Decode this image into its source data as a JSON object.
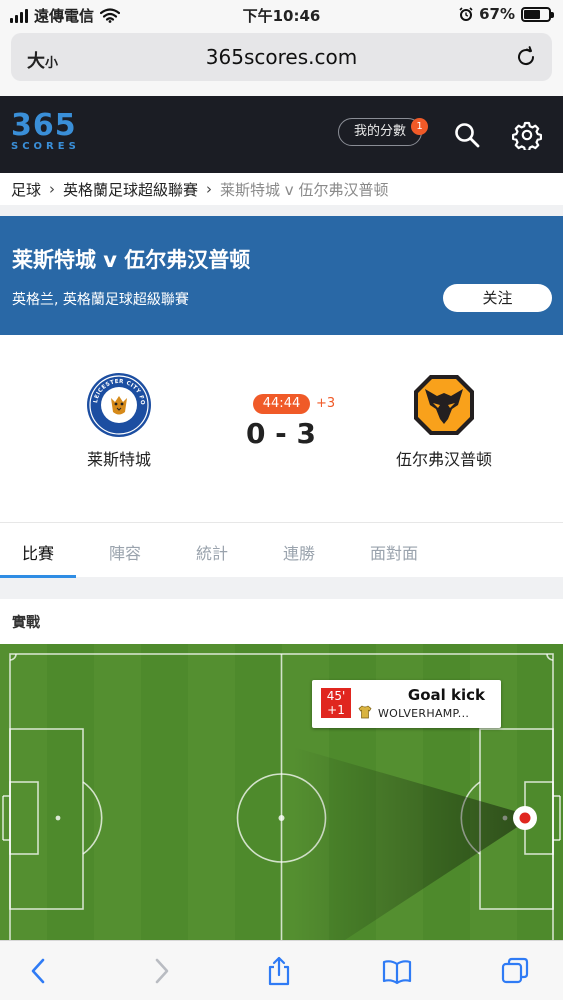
{
  "status_bar": {
    "carrier": "遠傳電信",
    "time": "下午10:46",
    "battery_pct": "67%",
    "battery_level": 0.67
  },
  "browser": {
    "text_size_label_big": "大",
    "text_size_label_small": "小",
    "url": "365scores.com"
  },
  "site": {
    "logo_number": "365",
    "logo_word": "SCORES",
    "my_scores_label": "我的分數",
    "notification_count": "1"
  },
  "breadcrumb": [
    "足球",
    "英格蘭足球超級聯賽",
    "莱斯特城 v 伍尔弗汉普顿"
  ],
  "match": {
    "title": "莱斯特城 v 伍尔弗汉普顿",
    "subtitle": "英格兰, 英格蘭足球超級聯賽",
    "follow_label": "关注",
    "home_team": "莱斯特城",
    "away_team": "伍尔弗汉普顿",
    "clock": "44:44",
    "added_time": "+3",
    "score": "0 - 3",
    "home_crest_text": "LEICESTER CITY FOOTBALL CLUB"
  },
  "tabs": [
    "比賽",
    "陣容",
    "統計",
    "連勝",
    "面對面"
  ],
  "active_tab": 0,
  "live": {
    "section_title": "實戰",
    "event": {
      "minute": "45'",
      "minute_extra": "+1",
      "title": "Goal kick",
      "team": "WOLVERHAMP..."
    }
  },
  "colors": {
    "header_bg": "#1b1d24",
    "banner_bg": "#2968a6",
    "accent_orange": "#f05a28",
    "tab_active_blue": "#2f8de4",
    "pitch_green": "#4e8a2c",
    "event_red": "#e0261f",
    "wolves_gold": "#f9a11b"
  },
  "icons": {
    "wifi": "wifi-icon",
    "alarm": "alarm-icon",
    "reload": "reload-icon",
    "search": "search-icon",
    "settings": "gear-icon",
    "back": "chevron-left-icon",
    "forward": "chevron-right-icon",
    "share": "share-icon",
    "bookmarks": "book-icon",
    "tabs": "tabs-icon"
  }
}
